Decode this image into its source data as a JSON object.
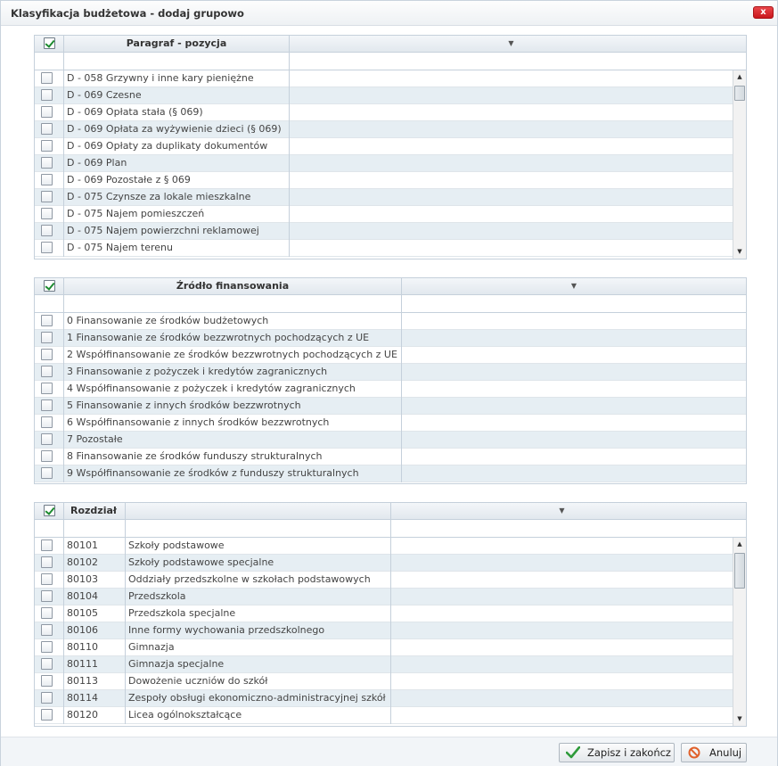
{
  "window": {
    "title": "Klasyfikacja budżetowa - dodaj grupowo",
    "close_label": "x"
  },
  "paragraf": {
    "header": "Paragraf - pozycja",
    "select_all_checked": true,
    "rows": [
      "D - 058 Grzywny i inne kary pieniężne",
      "D - 069 Czesne",
      "D - 069 Opłata stała (§ 069)",
      "D - 069 Opłata za wyżywienie dzieci (§ 069)",
      "D - 069 Opłaty za duplikaty dokumentów",
      "D - 069 Plan",
      "D - 069 Pozostałe z § 069",
      "D - 075 Czynsze za lokale mieszkalne",
      "D - 075 Najem pomieszczeń",
      "D - 075 Najem powierzchni reklamowej",
      "D - 075 Najem terenu"
    ]
  },
  "zrodlo": {
    "header": "Źródło finansowania",
    "select_all_checked": true,
    "rows": [
      "0 Finansowanie ze środków budżetowych",
      "1 Finansowanie ze środków bezzwrotnych pochodzących z UE",
      "2 Współfinansowanie ze środków bezzwrotnych pochodzących z UE",
      "3 Finansowanie z pożyczek i kredytów zagranicznych",
      "4 Współfinansowanie z pożyczek i kredytów zagranicznych",
      "5 Finansowanie z innych środków bezzwrotnych",
      "6 Współfinansowanie z innych środków bezzwrotnych",
      "7 Pozostałe",
      "8 Finansowanie ze środków funduszy strukturalnych",
      "9 Współfinansowanie ze środków z funduszy strukturalnych"
    ]
  },
  "rozdzial": {
    "header": "Rozdział",
    "select_all_checked": true,
    "rows": [
      {
        "code": "80101",
        "name": "Szkoły podstawowe"
      },
      {
        "code": "80102",
        "name": "Szkoły podstawowe specjalne"
      },
      {
        "code": "80103",
        "name": "Oddziały przedszkolne w szkołach podstawowych"
      },
      {
        "code": "80104",
        "name": "Przedszkola"
      },
      {
        "code": "80105",
        "name": "Przedszkola specjalne"
      },
      {
        "code": "80106",
        "name": "Inne formy wychowania przedszkolnego"
      },
      {
        "code": "80110",
        "name": "Gimnazja"
      },
      {
        "code": "80111",
        "name": "Gimnazja specjalne"
      },
      {
        "code": "80113",
        "name": "Dowożenie uczniów do szkół"
      },
      {
        "code": "80114",
        "name": "Zespoły obsługi ekonomiczno-administracyjnej szkół"
      },
      {
        "code": "80120",
        "name": "Licea ogólnokształcące"
      }
    ]
  },
  "footer": {
    "save_label": "Zapisz i zakończ",
    "cancel_label": "Anuluj"
  },
  "colors": {
    "row_alt": "#e6eef3",
    "grid_border": "#c5d0db",
    "check_green": "#1c8a2f",
    "close_red": "#d3262b"
  },
  "icons": {
    "save": "checkmark-icon",
    "cancel": "no-entry-icon",
    "dropdown": "triangle-down-icon"
  }
}
